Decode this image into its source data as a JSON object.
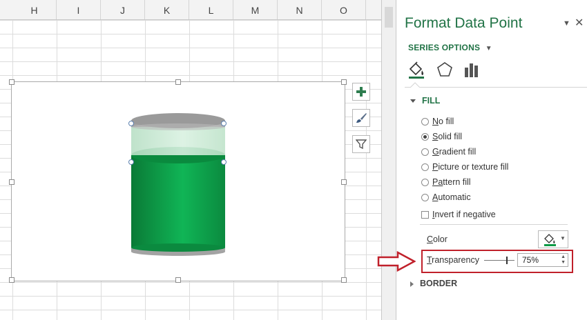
{
  "sheet": {
    "columns": [
      "H",
      "I",
      "J",
      "K",
      "L",
      "M",
      "N",
      "O"
    ]
  },
  "chart": {
    "tools": [
      {
        "name": "chart-elements",
        "icon": "plus-icon"
      },
      {
        "name": "chart-styles",
        "icon": "brush-icon"
      },
      {
        "name": "chart-filters",
        "icon": "funnel-icon"
      }
    ],
    "cylinder_colors": {
      "top": "#9a9a9a",
      "upper_transparent": "#cfe9d7",
      "body_green": "#0c9a46",
      "base": "#c9c9c9"
    }
  },
  "pane": {
    "title": "Format Data Point",
    "series_options": "SERIES OPTIONS",
    "tabs": [
      "fill-line-icon",
      "effects-icon",
      "series-options-icon"
    ],
    "fill_section": "FILL",
    "fill_options": [
      {
        "label": "No fill",
        "u": "N",
        "rest": "o fill",
        "selected": false
      },
      {
        "label": "Solid fill",
        "u": "S",
        "rest": "olid fill",
        "selected": true
      },
      {
        "label": "Gradient fill",
        "u": "G",
        "rest": "radient fill",
        "selected": false
      },
      {
        "label": "Picture or texture fill",
        "u": "P",
        "rest": "icture or texture fill",
        "selected": false
      },
      {
        "label": "Pattern fill",
        "u": "Pa",
        "rest": "ttern fill",
        "selected": false
      },
      {
        "label": "Automatic",
        "u": "A",
        "rest": "utomatic",
        "selected": false
      }
    ],
    "invert": {
      "u": "I",
      "rest": "nvert if negative",
      "checked": false
    },
    "color_label": {
      "u": "C",
      "rest": "olor"
    },
    "transparency_label": {
      "u": "T",
      "rest": "ransparency"
    },
    "transparency_value": "75%",
    "transparency_fraction": 0.75,
    "border_section": "BORDER",
    "accent": "#217346",
    "highlight_color": "#c0202a"
  }
}
